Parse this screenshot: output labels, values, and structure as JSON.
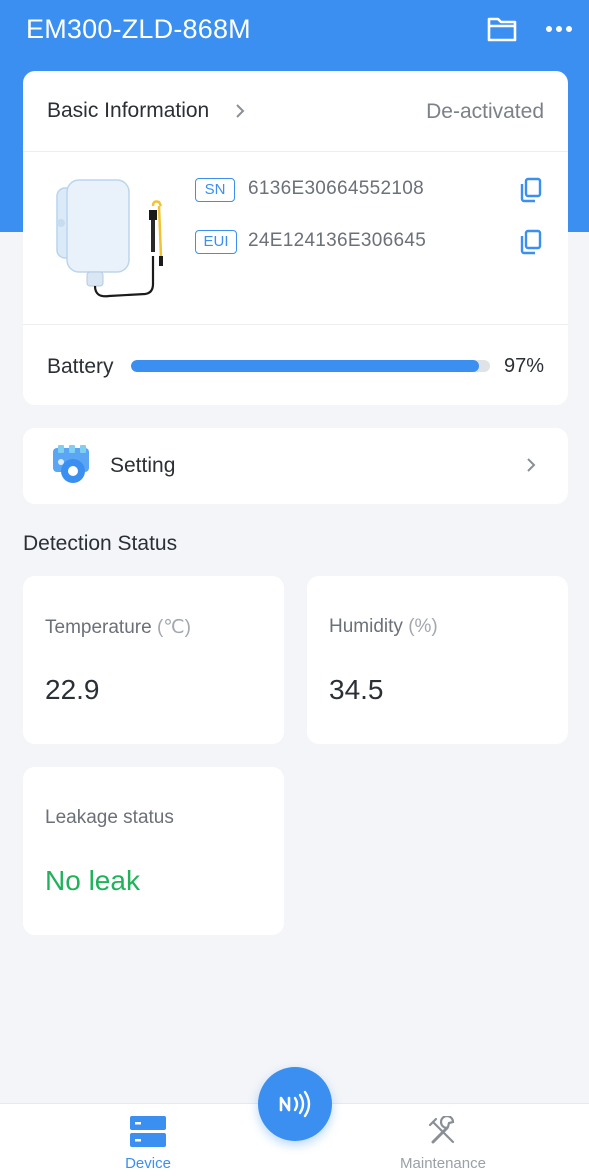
{
  "header": {
    "title": "EM300-ZLD-868M",
    "icons": [
      "folder-icon",
      "more-icon"
    ]
  },
  "basic_info": {
    "label": "Basic Information",
    "status": "De-activated",
    "sn_tag": "SN",
    "sn_value": "6136E30664552108",
    "eui_tag": "EUI",
    "eui_value": "24E124136E306645",
    "battery_label": "Battery",
    "battery_percent": 97,
    "battery_text": "97%"
  },
  "setting": {
    "label": "Setting"
  },
  "detection": {
    "title": "Detection Status",
    "temperature": {
      "label": "Temperature",
      "unit": "(℃)",
      "value": "22.9"
    },
    "humidity": {
      "label": "Humidity",
      "unit": "(%)",
      "value": "34.5"
    },
    "leakage": {
      "label": "Leakage status",
      "value": "No leak"
    }
  },
  "nav": {
    "items": [
      {
        "label": "Device",
        "icon": "device-icon",
        "active": true
      },
      {
        "label": "Maintenance",
        "icon": "tools-icon",
        "active": false
      }
    ],
    "fab_icon": "nfc-icon"
  },
  "colors": {
    "primary": "#3a8ff0",
    "success": "#1fb25a",
    "background": "#f3f5f8"
  }
}
